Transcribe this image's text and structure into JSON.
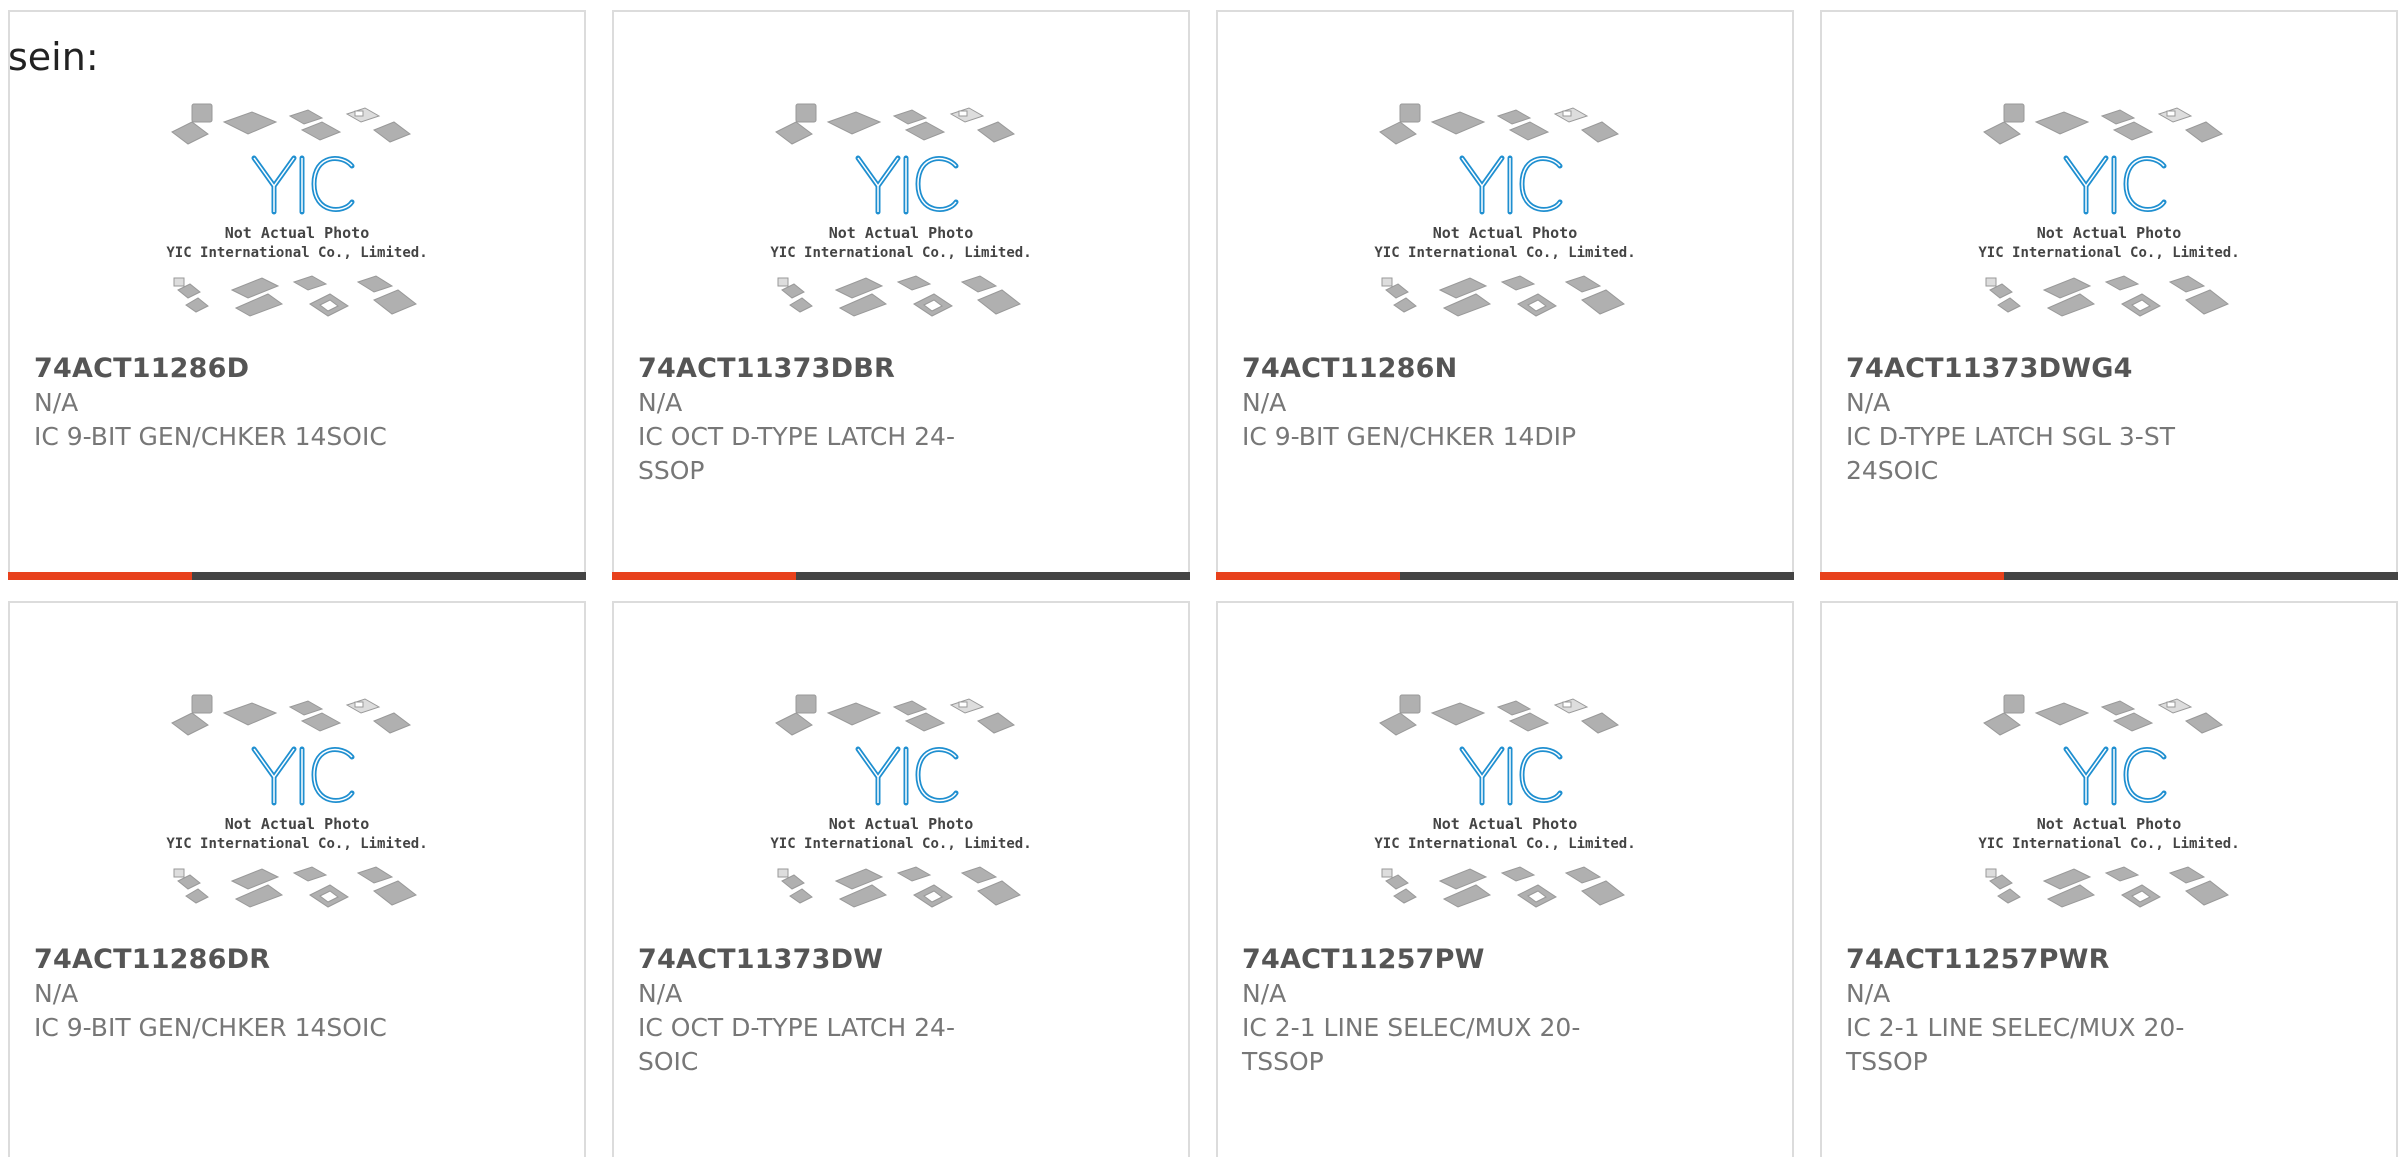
{
  "header": {
    "label": "sein:"
  },
  "placeholder_image": {
    "line1": "Not Actual Photo",
    "line2": "YIC International Co., Limited.",
    "logo_text": "YIC"
  },
  "colors": {
    "accent": "#e8411c",
    "bar": "#444444",
    "logo_blue": "#1f8fd0",
    "chip_gray": "#b0b0b0"
  },
  "products": [
    {
      "part": "74ACT11286D",
      "mfr": "N/A",
      "desc": "IC 9-BIT GEN/CHKER 14SOIC"
    },
    {
      "part": "74ACT11373DBR",
      "mfr": "N/A",
      "desc": "IC OCT D-TYPE LATCH 24-SSOP"
    },
    {
      "part": "74ACT11286N",
      "mfr": "N/A",
      "desc": "IC 9-BIT GEN/CHKER 14DIP"
    },
    {
      "part": "74ACT11373DWG4",
      "mfr": "N/A",
      "desc": "IC D-TYPE LATCH SGL 3-ST 24SOIC"
    },
    {
      "part": "74ACT11286DR",
      "mfr": "N/A",
      "desc": "IC 9-BIT GEN/CHKER 14SOIC"
    },
    {
      "part": "74ACT11373DW",
      "mfr": "N/A",
      "desc": "IC OCT D-TYPE LATCH 24-SOIC"
    },
    {
      "part": "74ACT11257PW",
      "mfr": "N/A",
      "desc": "IC 2-1 LINE SELEC/MUX 20-TSSOP"
    },
    {
      "part": "74ACT11257PWR",
      "mfr": "N/A",
      "desc": "IC 2-1 LINE SELEC/MUX 20-TSSOP"
    }
  ]
}
